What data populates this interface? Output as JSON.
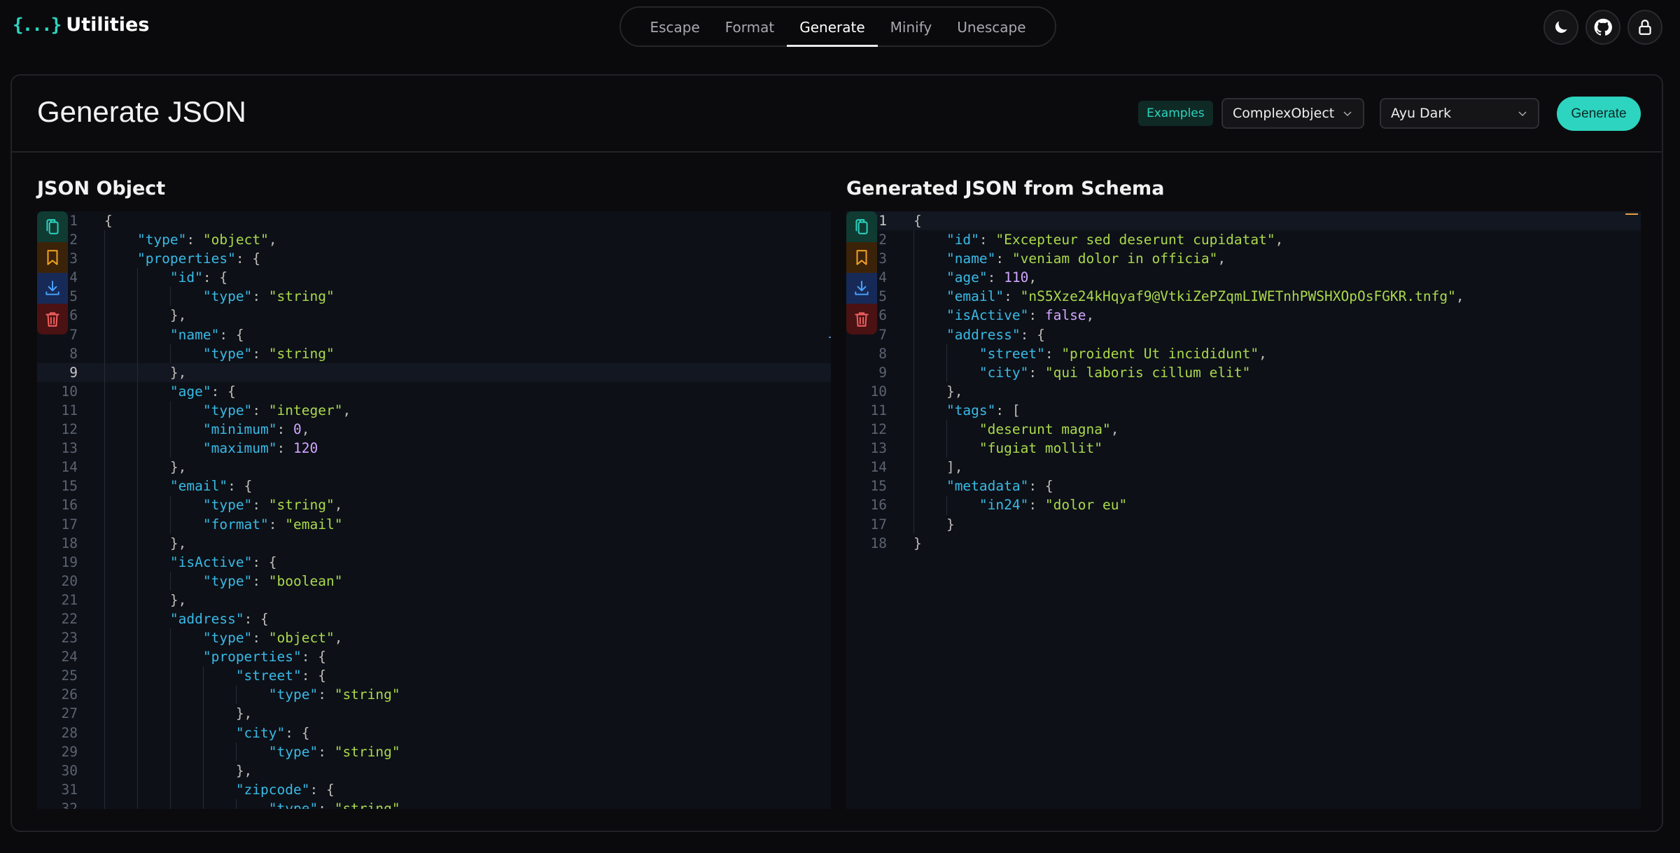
{
  "app": {
    "logo_mark": "{...}",
    "title": "Utilities"
  },
  "nav": {
    "items": [
      {
        "label": "Escape"
      },
      {
        "label": "Format"
      },
      {
        "label": "Generate",
        "active": true
      },
      {
        "label": "Minify"
      },
      {
        "label": "Unescape"
      }
    ]
  },
  "header_icons": [
    "moon-icon",
    "github-icon",
    "lock-icon"
  ],
  "page": {
    "title": "Generate JSON",
    "examples_label": "Examples",
    "example_select": "ComplexObject",
    "theme_select": "Ayu Dark",
    "generate_label": "Generate"
  },
  "colors": {
    "accent": "#2dd4bf",
    "key": "#39bae6",
    "string": "#aad94c",
    "number": "#d2a6ff",
    "copy_bg": "#0f3b33",
    "bookmark_bg": "#3b2309",
    "download_bg": "#172a57",
    "delete_bg": "#4a1212"
  },
  "left": {
    "title": "JSON Object",
    "active_line": 9,
    "lines": [
      "{",
      "    \"type\": \"object\",",
      "    \"properties\": {",
      "        \"id\": {",
      "            \"type\": \"string\"",
      "        },",
      "        \"name\": {",
      "            \"type\": \"string\"",
      "        },",
      "        \"age\": {",
      "            \"type\": \"integer\",",
      "            \"minimum\": 0,",
      "            \"maximum\": 120",
      "        },",
      "        \"email\": {",
      "            \"type\": \"string\",",
      "            \"format\": \"email\"",
      "        },",
      "        \"isActive\": {",
      "            \"type\": \"boolean\"",
      "        },",
      "        \"address\": {",
      "            \"type\": \"object\",",
      "            \"properties\": {",
      "                \"street\": {",
      "                    \"type\": \"string\"",
      "                },",
      "                \"city\": {",
      "                    \"type\": \"string\"",
      "                },",
      "                \"zipcode\": {",
      "                    \"type\": \"string\""
    ]
  },
  "right": {
    "title": "Generated JSON from Schema",
    "active_line": 1,
    "lines": [
      "{",
      "    \"id\": \"Excepteur sed deserunt cupidatat\",",
      "    \"name\": \"veniam dolor in officia\",",
      "    \"age\": 110,",
      "    \"email\": \"nS5Xze24kHqyaf9@VtkiZePZqmLIWETnhPWSHXOpOsFGKR.tnfg\",",
      "    \"isActive\": false,",
      "    \"address\": {",
      "        \"street\": \"proident Ut incididunt\",",
      "        \"city\": \"qui laboris cillum elit\"",
      "    },",
      "    \"tags\": [",
      "        \"deserunt magna\",",
      "        \"fugiat mollit\"",
      "    ],",
      "    \"metadata\": {",
      "        \"in24\": \"dolor eu\"",
      "    }",
      "}"
    ]
  }
}
